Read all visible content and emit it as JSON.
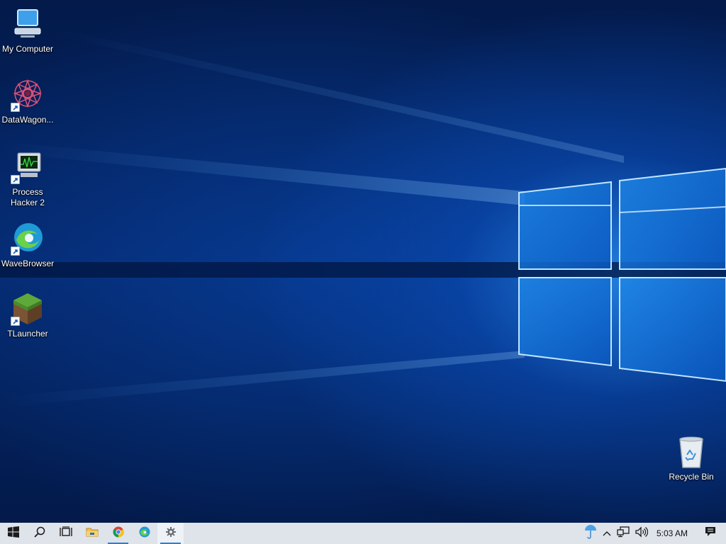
{
  "desktop": {
    "icons": [
      {
        "label": "My Computer"
      },
      {
        "label": "DataWagon..."
      },
      {
        "label": "Process\nHacker 2"
      },
      {
        "label": "WaveBrowser"
      },
      {
        "label": "TLauncher"
      },
      {
        "label": "Recycle Bin"
      }
    ]
  },
  "taskbar": {
    "buttons": [
      "start-icon",
      "search-icon",
      "task-view-icon",
      "file-explorer-icon",
      "chrome-icon",
      "wavebrowser-icon",
      "settings-icon"
    ],
    "tray": {
      "icons": [
        "umbrella-icon",
        "chevron-up-icon",
        "network-icon",
        "volume-icon",
        "notifications-icon"
      ],
      "clock": "5:03 AM"
    }
  },
  "colors": {
    "taskbar_bg": "#dfe3ea",
    "accent": "#2a7fd4",
    "wallpaper_dark": "#031a4a",
    "wallpaper_glow": "#2a8cf0"
  }
}
